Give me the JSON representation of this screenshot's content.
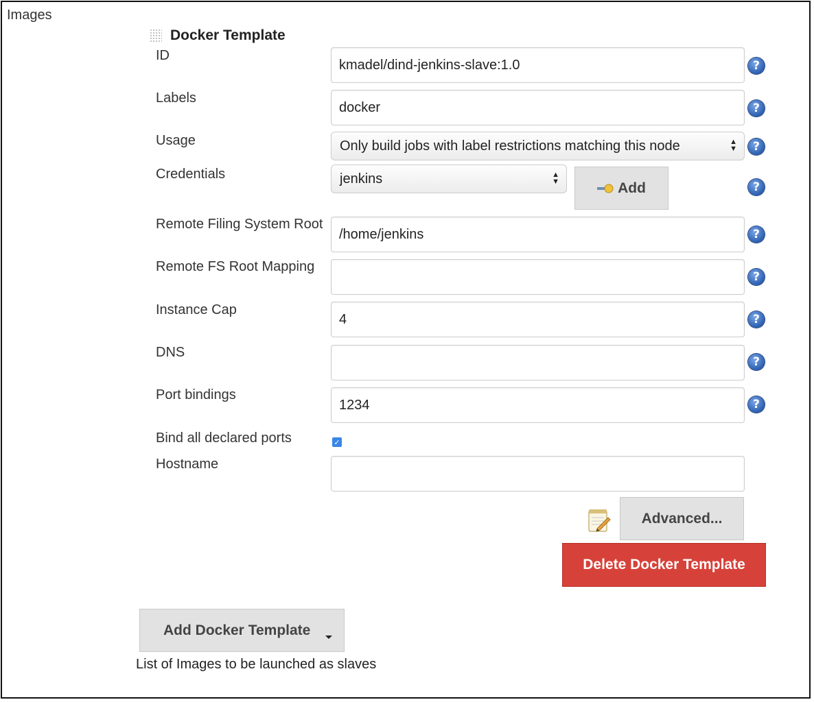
{
  "section": {
    "title": "Images"
  },
  "template": {
    "title": "Docker Template",
    "fields": {
      "id": {
        "label": "ID",
        "value": "kmadel/dind-jenkins-slave:1.0"
      },
      "labels": {
        "label": "Labels",
        "value": "docker"
      },
      "usage": {
        "label": "Usage",
        "value": "Only build jobs with label restrictions matching this node"
      },
      "credentials": {
        "label": "Credentials",
        "value": "jenkins",
        "add_label": "Add"
      },
      "remote_fs_root": {
        "label": "Remote Filing System Root",
        "value": "/home/jenkins"
      },
      "remote_fs_mapping": {
        "label": "Remote FS Root Mapping",
        "value": ""
      },
      "instance_cap": {
        "label": "Instance Cap",
        "value": "4"
      },
      "dns": {
        "label": "DNS",
        "value": ""
      },
      "port_bindings": {
        "label": "Port bindings",
        "value": "1234"
      },
      "bind_all_ports": {
        "label": "Bind all declared ports",
        "checked": true
      },
      "hostname": {
        "label": "Hostname",
        "value": ""
      }
    },
    "help_glyph": "?",
    "advanced_label": "Advanced...",
    "delete_label": "Delete Docker Template"
  },
  "add_template": {
    "label": "Add Docker Template"
  },
  "footer": {
    "description": "List of Images to be launched as slaves"
  },
  "colors": {
    "delete": "#d6423a",
    "help": "#2c5fb0",
    "checkbox": "#3a86e8"
  }
}
